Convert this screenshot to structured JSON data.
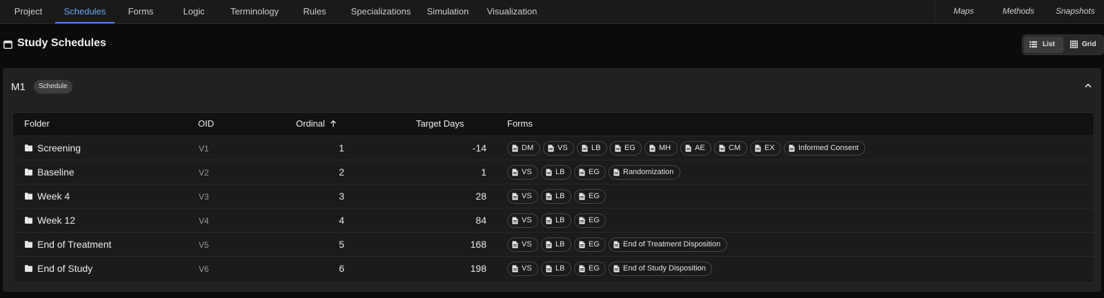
{
  "nav": {
    "tabs": [
      "Project",
      "Schedules",
      "Forms",
      "Logic",
      "Terminology",
      "Rules",
      "Specializations",
      "Simulation",
      "Visualization"
    ],
    "active": "Schedules",
    "right_tabs": [
      "Maps",
      "Methods",
      "Snapshots"
    ]
  },
  "header": {
    "title": "Study Schedules",
    "view_list": "List",
    "view_grid": "Grid",
    "view_active": "List"
  },
  "schedule": {
    "name": "M1",
    "badge": "Schedule"
  },
  "table": {
    "columns": [
      "Folder",
      "OID",
      "Ordinal",
      "Target Days",
      "Forms"
    ],
    "sort_column": "Ordinal",
    "sort_dir": "ascending",
    "rows": [
      {
        "folder": "Screening",
        "oid": "V1",
        "ordinal": "1",
        "target_days": "-14",
        "forms": [
          "DM",
          "VS",
          "LB",
          "EG",
          "MH",
          "AE",
          "CM",
          "EX",
          "Informed Consent"
        ]
      },
      {
        "folder": "Baseline",
        "oid": "V2",
        "ordinal": "2",
        "target_days": "1",
        "forms": [
          "VS",
          "LB",
          "EG",
          "Randomization"
        ]
      },
      {
        "folder": "Week 4",
        "oid": "V3",
        "ordinal": "3",
        "target_days": "28",
        "forms": [
          "VS",
          "LB",
          "EG"
        ]
      },
      {
        "folder": "Week 12",
        "oid": "V4",
        "ordinal": "4",
        "target_days": "84",
        "forms": [
          "VS",
          "LB",
          "EG"
        ]
      },
      {
        "folder": "End of Treatment",
        "oid": "V5",
        "ordinal": "5",
        "target_days": "168",
        "forms": [
          "VS",
          "LB",
          "EG",
          "End of Treatment Disposition"
        ]
      },
      {
        "folder": "End of Study",
        "oid": "V6",
        "ordinal": "6",
        "target_days": "198",
        "forms": [
          "VS",
          "LB",
          "EG",
          "End of Study Disposition"
        ]
      }
    ]
  },
  "colors": {
    "accent": "#4a8fe8",
    "background": "#0b0b0b",
    "card": "#212121"
  }
}
